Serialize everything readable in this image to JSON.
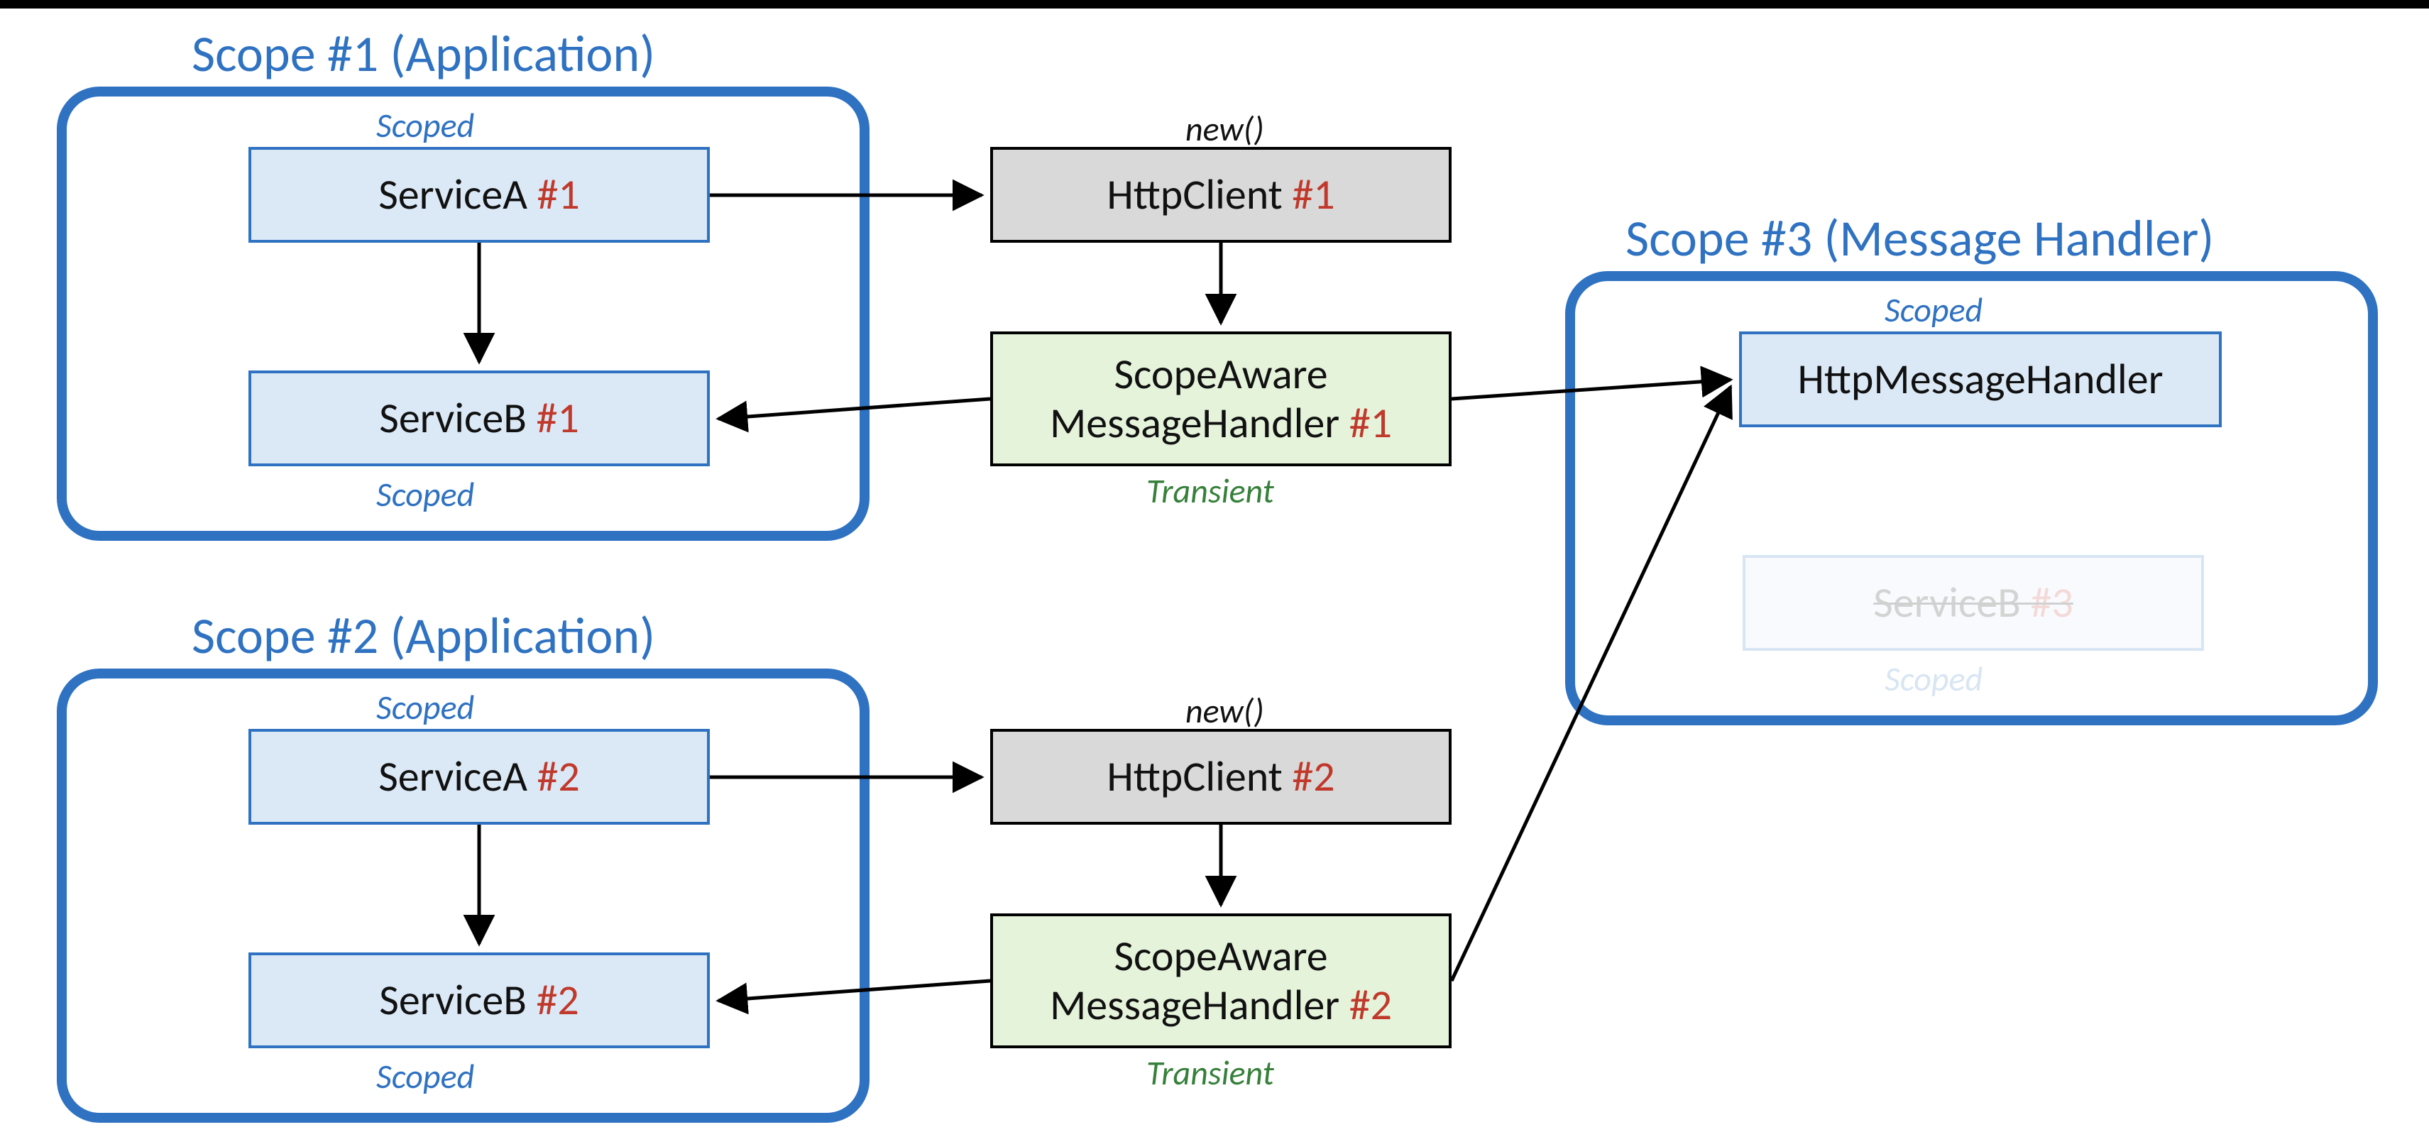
{
  "colors": {
    "scopeBorder": "#2f72c2",
    "scopeText": "#2f72c2",
    "red": "#c0392b",
    "green": "#36803a",
    "nodeBlue": "#dbe9f7",
    "nodeGray": "#d9d9d9",
    "nodeGreen": "#e5f3db"
  },
  "scopes": {
    "s1": {
      "title": "Scope #1 (Application)"
    },
    "s2": {
      "title": "Scope #2 (Application)"
    },
    "s3": {
      "title": "Scope #3 (Message Handler)"
    }
  },
  "tags": {
    "scoped": "Scoped",
    "transient": "Transient",
    "new": "new()"
  },
  "nodes": {
    "serviceA1": {
      "label": "ServiceA ",
      "suffix": "#1"
    },
    "serviceB1": {
      "label": "ServiceB ",
      "suffix": "#1"
    },
    "httpClient1": {
      "label": "HttpClient ",
      "suffix": "#1"
    },
    "scopeAware1_l1": "ScopeAware",
    "scopeAware1_l2a": "MessageHandler ",
    "scopeAware1_l2b": "#1",
    "serviceA2": {
      "label": "ServiceA ",
      "suffix": "#2"
    },
    "serviceB2": {
      "label": "ServiceB ",
      "suffix": "#2"
    },
    "httpClient2": {
      "label": "HttpClient ",
      "suffix": "#2"
    },
    "scopeAware2_l1": "ScopeAware",
    "scopeAware2_l2a": "MessageHandler ",
    "scopeAware2_l2b": "#2",
    "httpMsgHandler": "HttpMessageHandler",
    "serviceB3": {
      "label": "ServiceB ",
      "suffix": "#3"
    }
  }
}
